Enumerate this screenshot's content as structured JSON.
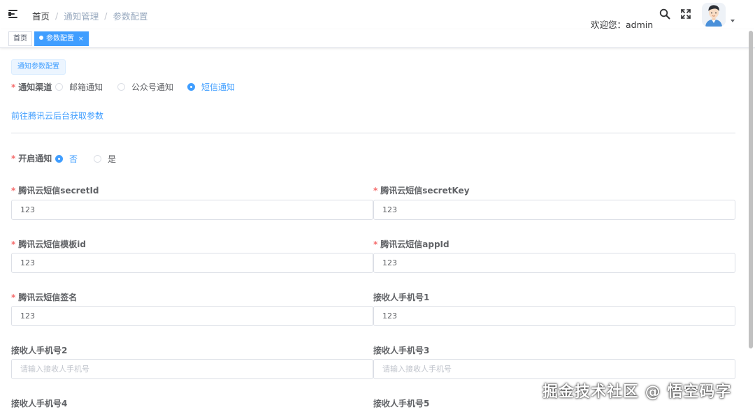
{
  "header": {
    "breadcrumb": [
      "首页",
      "通知管理",
      "参数配置"
    ],
    "welcome": "欢迎您：admin"
  },
  "tags": {
    "home": "首页",
    "active": "参数配置",
    "close": "×"
  },
  "form": {
    "section_chip": "通知参数配置",
    "channel_label": "通知渠道",
    "channel_options": [
      "邮箱通知",
      "公众号通知",
      "短信通知"
    ],
    "channel_selected": "短信通知",
    "link_text": "前往腾讯云后台获取参数",
    "enable_label": "开启通知",
    "enable_options": [
      "否",
      "是"
    ],
    "enable_selected": "否",
    "required_mark": "*",
    "fields": [
      {
        "label": "腾讯云短信secretId",
        "value": "123",
        "placeholder": "",
        "required": true
      },
      {
        "label": "腾讯云短信secretKey",
        "value": "123",
        "placeholder": "",
        "required": true
      },
      {
        "label": "腾讯云短信模板id",
        "value": "123",
        "placeholder": "",
        "required": true
      },
      {
        "label": "腾讯云短信appId",
        "value": "123",
        "placeholder": "",
        "required": true
      },
      {
        "label": "腾讯云短信签名",
        "value": "123",
        "placeholder": "",
        "required": true
      },
      {
        "label": "接收人手机号1",
        "value": "123",
        "placeholder": "",
        "required": false
      },
      {
        "label": "接收人手机号2",
        "value": "",
        "placeholder": "请输入接收人手机号",
        "required": false
      },
      {
        "label": "接收人手机号3",
        "value": "",
        "placeholder": "请输入接收人手机号",
        "required": false
      },
      {
        "label": "接收人手机号4",
        "value": "",
        "placeholder": "",
        "required": false
      },
      {
        "label": "接收人手机号5",
        "value": "",
        "placeholder": "",
        "required": false
      }
    ]
  },
  "watermark": "掘金技术社区 @ 悟空码字",
  "colors": {
    "primary": "#409eff",
    "required": "#f56c6c",
    "text": "#303133",
    "border": "#dcdfe6"
  }
}
